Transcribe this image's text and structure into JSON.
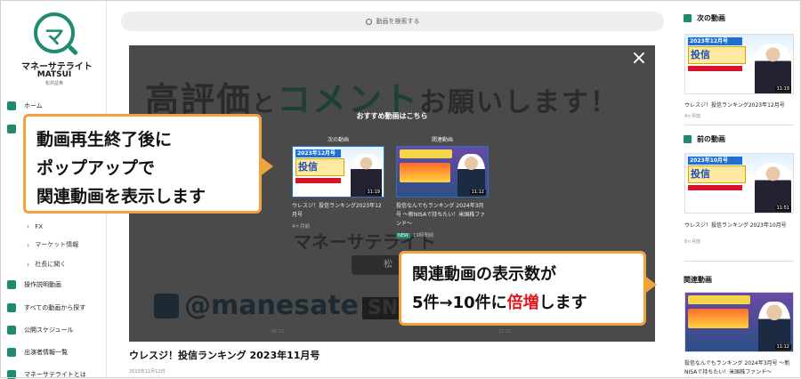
{
  "sidebar": {
    "logo": {
      "mark": "マ",
      "name": "マネーサテライト",
      "sub": "MATSUI",
      "tiny": "松井証券"
    },
    "items": [
      {
        "label": "ホーム",
        "icon": "home-icon"
      },
      {
        "label": "FX",
        "icon": "chevron-right-icon",
        "sub": true
      },
      {
        "label": "マーケット情報",
        "icon": "chevron-right-icon",
        "sub": true
      },
      {
        "label": "社長に聞く",
        "icon": "chevron-right-icon",
        "sub": true
      },
      {
        "label": "操作説明動画",
        "icon": "book-icon"
      },
      {
        "label": "すべての動画から探す",
        "icon": "video-icon"
      },
      {
        "label": "公開スケジュール",
        "icon": "calendar-icon"
      },
      {
        "label": "出演者情報一覧",
        "icon": "person-icon"
      },
      {
        "label": "マネーサテライトとは",
        "icon": "help-icon"
      }
    ]
  },
  "search": {
    "placeholder": "動画を検索する"
  },
  "video": {
    "bg_title_a": "高評価",
    "bg_title_b": "と",
    "bg_title_c": "コメント",
    "bg_title_d": "お願いします！",
    "bg_twitter": "@manesate",
    "bg_sns": "SNS",
    "bg_logo": "マネーサテライト",
    "bg_button": "松",
    "popup_title": "おすすめ動画はこちら",
    "recs": [
      {
        "label": "次の動画",
        "title": "ウレスジ！投信ランキング2023年12月号",
        "date": "4ヶ月前",
        "duration": "11:19",
        "thumb_big": "投信",
        "thumb_bar": "2023年12月号"
      },
      {
        "label": "関連動画",
        "title": "投信なんでもランキング 2024年3月号 ～新NISAで持ちたい！米国株ファンド～",
        "date": "19時間前",
        "badge": "NEW",
        "duration": "11:12"
      }
    ],
    "time_left": "00:21",
    "time_right": "12:21",
    "close": "×"
  },
  "callouts": {
    "c1_lines": [
      "動画再生終了後に",
      "ポップアップで",
      "関連動画を表示します"
    ],
    "c2_line1": "関連動画の表示数が",
    "c2_line2_a": "5件→10件に",
    "c2_line2_b": "倍増",
    "c2_line2_c": "します"
  },
  "main": {
    "title": "ウレスジ！投信ランキング 2023年11月号",
    "date": "2023年11月12日"
  },
  "right": {
    "next": {
      "label": "次の動画",
      "title": "ウレスジ！投信ランキング2023年12月号",
      "date": "4ヶ月前",
      "duration": "11:19",
      "thumb_bar": "2023年12月号",
      "thumb_big": "投信"
    },
    "prev": {
      "label": "前の動画",
      "title": "ウレスジ！投信ランキング 2023年10月号",
      "date": "6ヶ月前",
      "duration": "11:51",
      "thumb_bar": "2023年10月号",
      "thumb_big": "投信"
    },
    "related": {
      "label": "関連動画",
      "title": "投信なんでもランキング 2024年3月号 ～新NISAで持ちたい！米国株ファンド～",
      "duration": "11:12"
    }
  },
  "colors": {
    "accent": "#1f8a70",
    "callout_border": "#f0a33a",
    "highlight_red": "#e0181b"
  }
}
